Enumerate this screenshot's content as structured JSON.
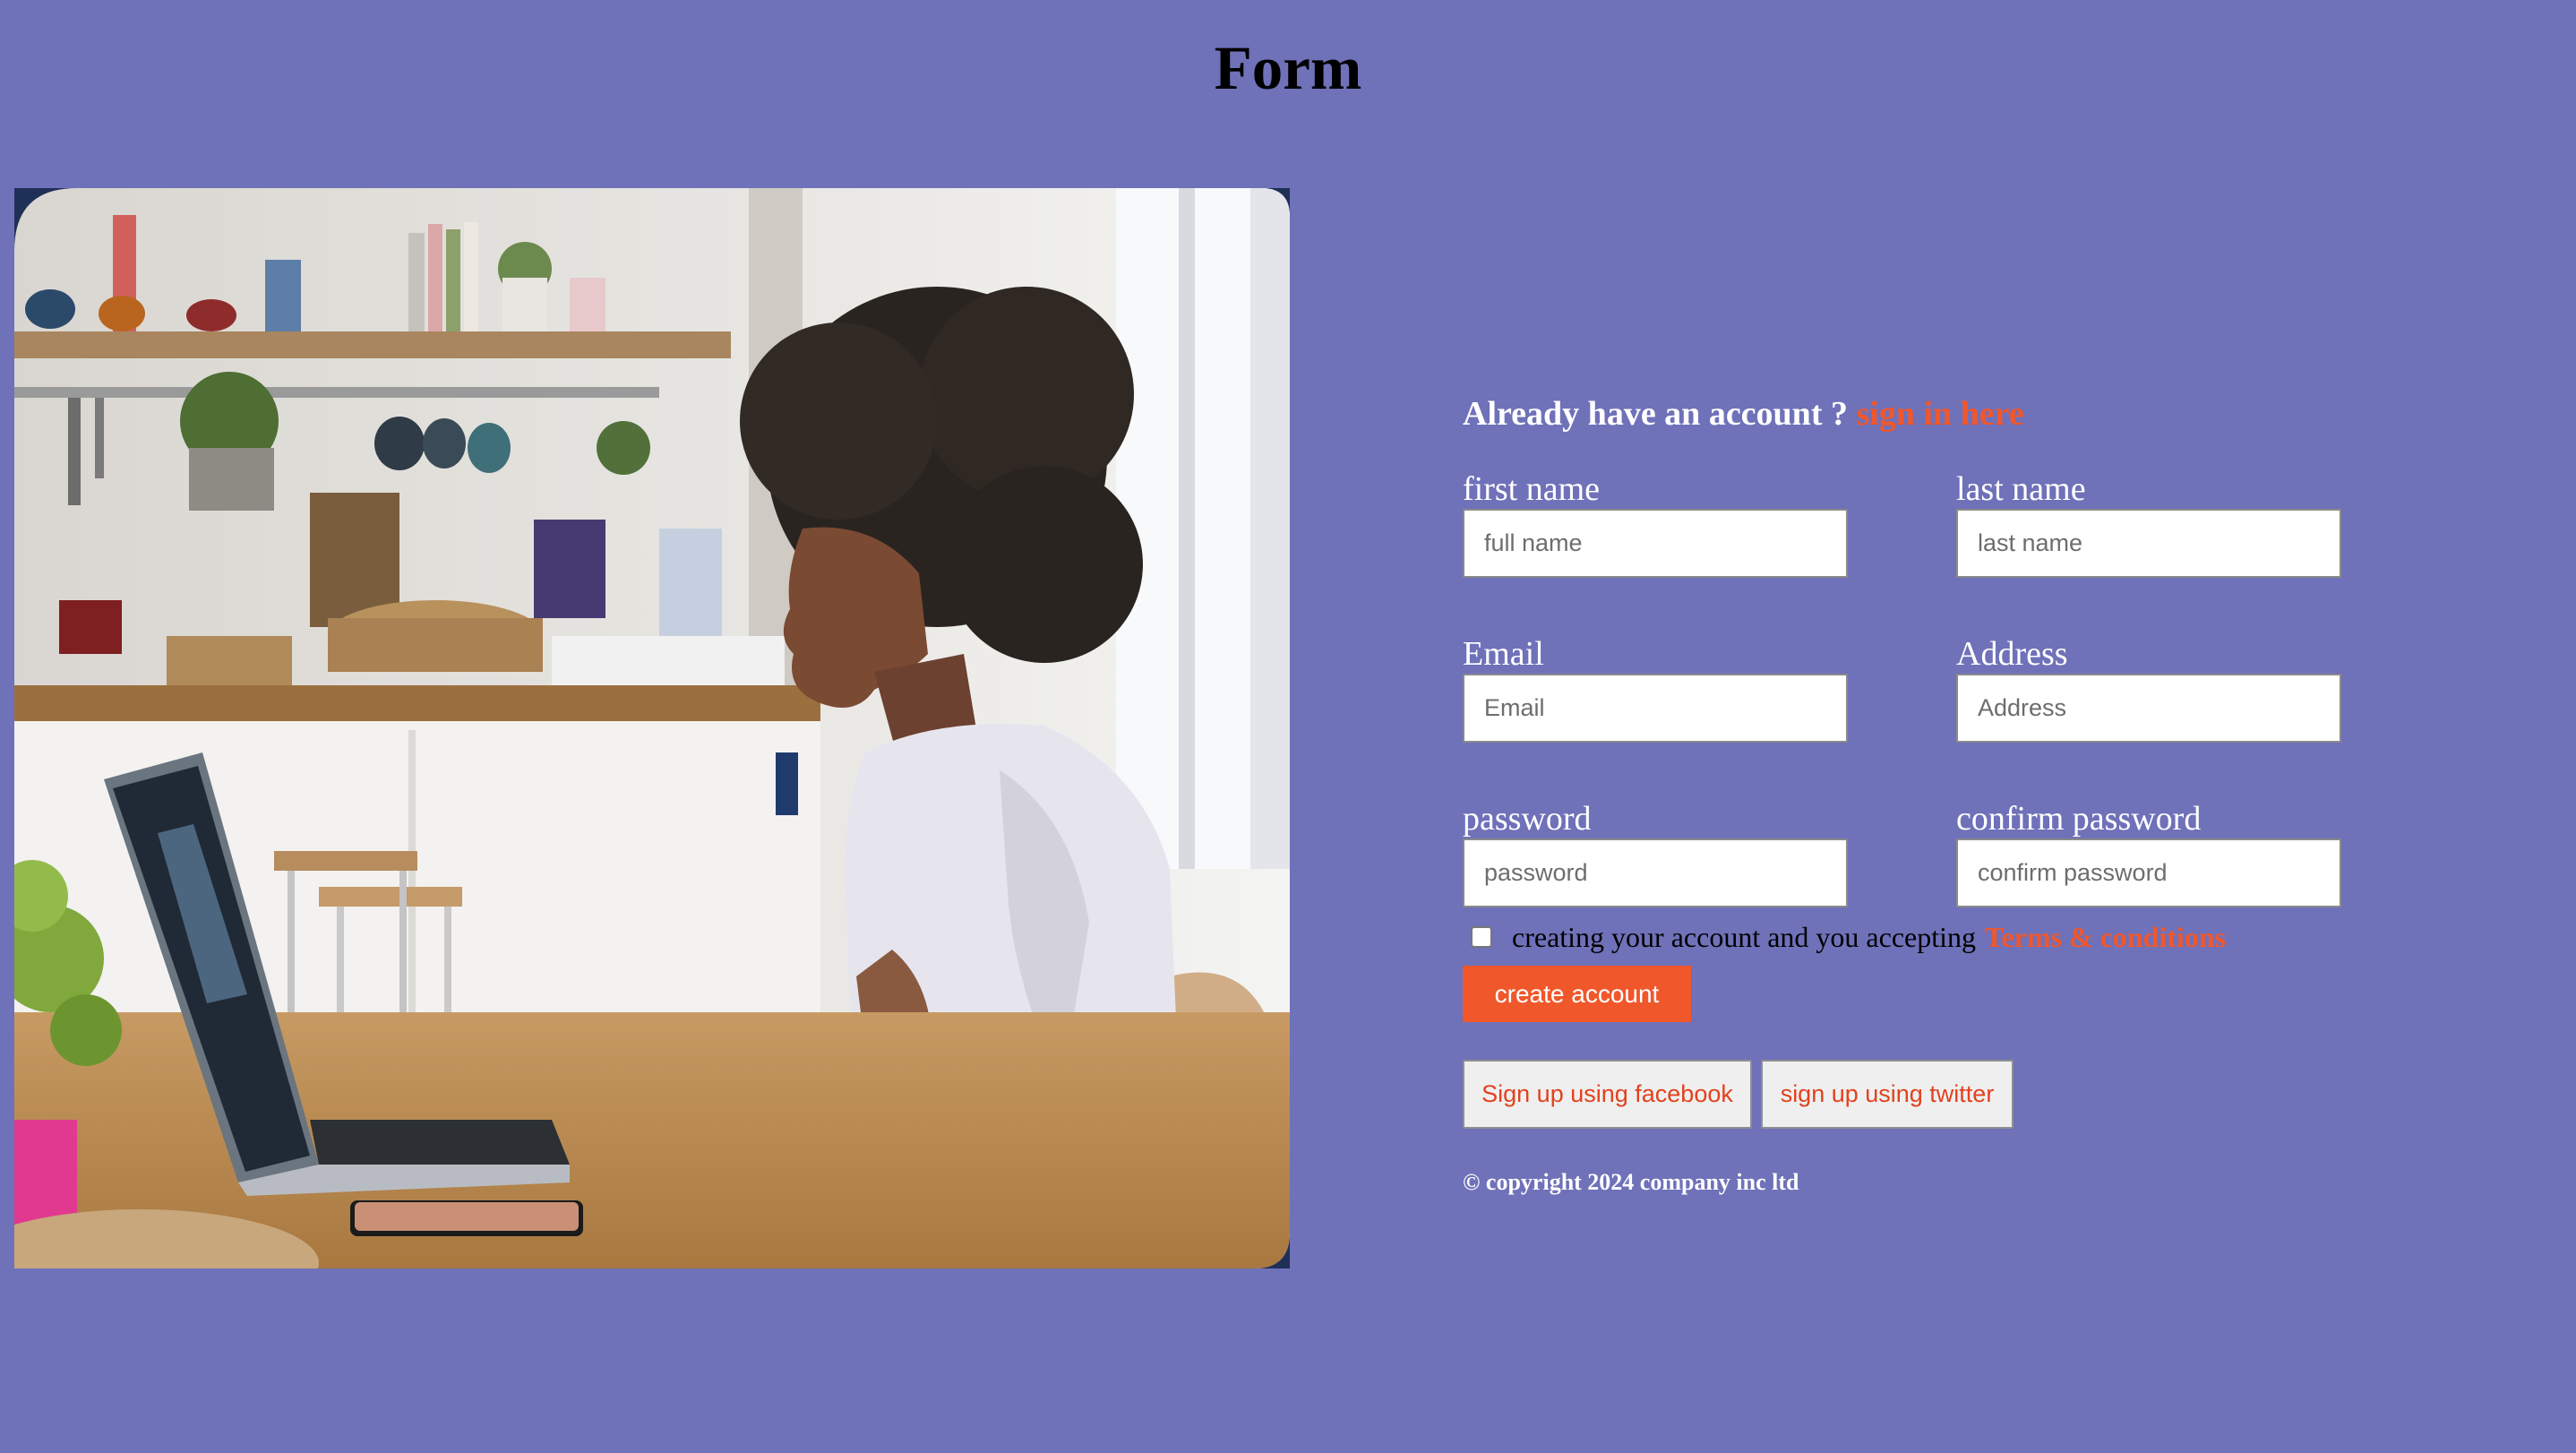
{
  "page": {
    "title": "Form"
  },
  "form": {
    "signin_prompt": "Already have an account ?",
    "signin_link": "sign in here",
    "fields": {
      "first_name": {
        "label": "first name",
        "placeholder": "full name"
      },
      "last_name": {
        "label": "last name",
        "placeholder": "last name"
      },
      "email": {
        "label": "Email",
        "placeholder": "Email"
      },
      "address": {
        "label": "Address",
        "placeholder": "Address"
      },
      "password": {
        "label": "password",
        "placeholder": "password"
      },
      "confirm_password": {
        "label": "confirm password",
        "placeholder": "confirm password"
      }
    },
    "terms_text": "creating your account and you accepting",
    "terms_link": "Terms & conditions",
    "terms_checked": false,
    "create_button": "create account",
    "facebook_button": "Sign up using facebook",
    "twitter_button": "sign up using twitter",
    "copyright": "© copyright 2024 company inc ltd"
  },
  "colors": {
    "background": "#6f71b9",
    "accent": "#f0572b",
    "text_light": "#ffffff",
    "text_dark": "#000000"
  }
}
